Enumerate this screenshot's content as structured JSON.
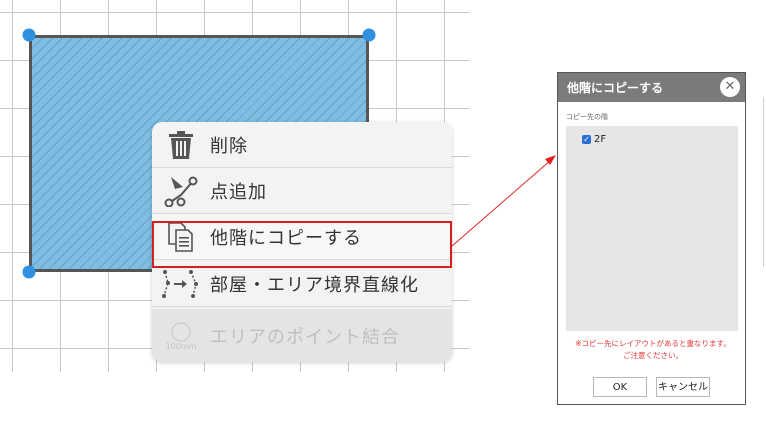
{
  "context_menu": {
    "items": [
      {
        "label": "削除",
        "icon": "trash-icon",
        "enabled": true
      },
      {
        "label": "点追加",
        "icon": "add-point-icon",
        "enabled": true
      },
      {
        "label": "他階にコピーする",
        "icon": "copy-document-icon",
        "enabled": true,
        "highlighted": true
      },
      {
        "label": "部屋・エリア境界直線化",
        "icon": "straighten-icon",
        "enabled": true
      },
      {
        "label": "エリアのポイント結合",
        "icon": "merge-points-icon",
        "enabled": false
      }
    ],
    "disabled_icon_text": "100mm"
  },
  "dialog": {
    "title": "他階にコピーする",
    "close_glyph": "✕",
    "section_label": "コピー先の階",
    "floors": [
      {
        "label": "2F",
        "checked": true
      }
    ],
    "warning_line1": "※コピー先にレイアウトがあると重なります。",
    "warning_line2": "ご注意ください。",
    "ok_label": "OK",
    "cancel_label": "キャンセル"
  },
  "colors": {
    "room_fill": "#7fbde2",
    "vertex": "#2f8fe0",
    "highlight": "#d42020",
    "dialog_header": "#7b7b7b",
    "warning": "#e03535"
  }
}
